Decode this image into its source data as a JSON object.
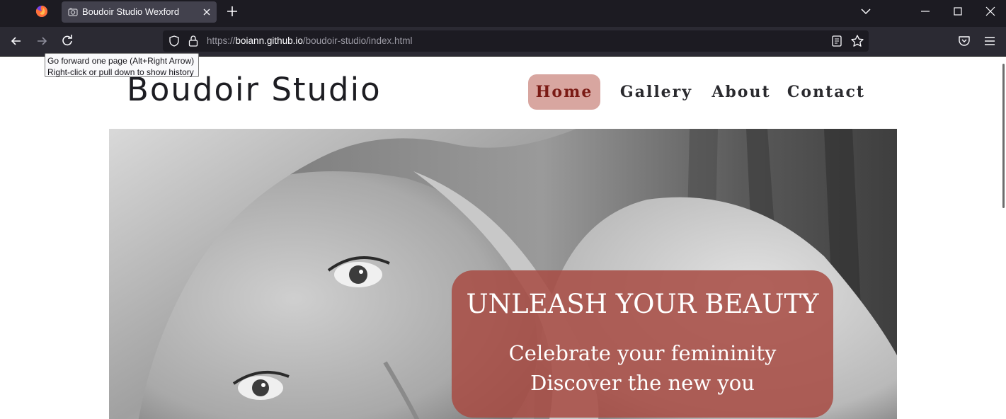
{
  "browser": {
    "tab_title": "Boudoir Studio Wexford",
    "url": {
      "prefix": "https://",
      "host": "boiann.github.io",
      "path": "/boudoir-studio/index.html"
    },
    "tooltip": {
      "line1": "Go forward one page (Alt+Right Arrow)",
      "line2": "Right-click or pull down to show history"
    },
    "colors": {
      "tabbar": "#1c1b22",
      "toolbar": "#2b2a33",
      "active_tab": "#42414d"
    }
  },
  "site": {
    "logo": "Boudoir Studio",
    "nav": [
      {
        "label": "Home",
        "active": true
      },
      {
        "label": "Gallery",
        "active": false
      },
      {
        "label": "About",
        "active": false
      },
      {
        "label": "Contact",
        "active": false
      }
    ],
    "hero": {
      "headline": "UNLEASH YOUR BEAUTY",
      "line1": "Celebrate your femininity",
      "line2": "Discover the new you"
    },
    "colors": {
      "nav_active_bg": "#d8a6a0",
      "nav_active_text": "#7a1a14",
      "hero_box": "#a84c44"
    }
  },
  "icons": {
    "firefox": "firefox-icon",
    "favicon": "camera-icon",
    "tab_close": "close-icon",
    "new_tab": "plus-icon",
    "list_tabs": "chevron-down-icon",
    "back": "arrow-left-icon",
    "forward": "arrow-right-icon",
    "reload": "reload-icon",
    "shield": "shield-icon",
    "lock": "lock-icon",
    "reader": "reader-view-icon",
    "bookmark": "star-icon",
    "pocket": "pocket-icon",
    "menu": "hamburger-menu-icon"
  }
}
